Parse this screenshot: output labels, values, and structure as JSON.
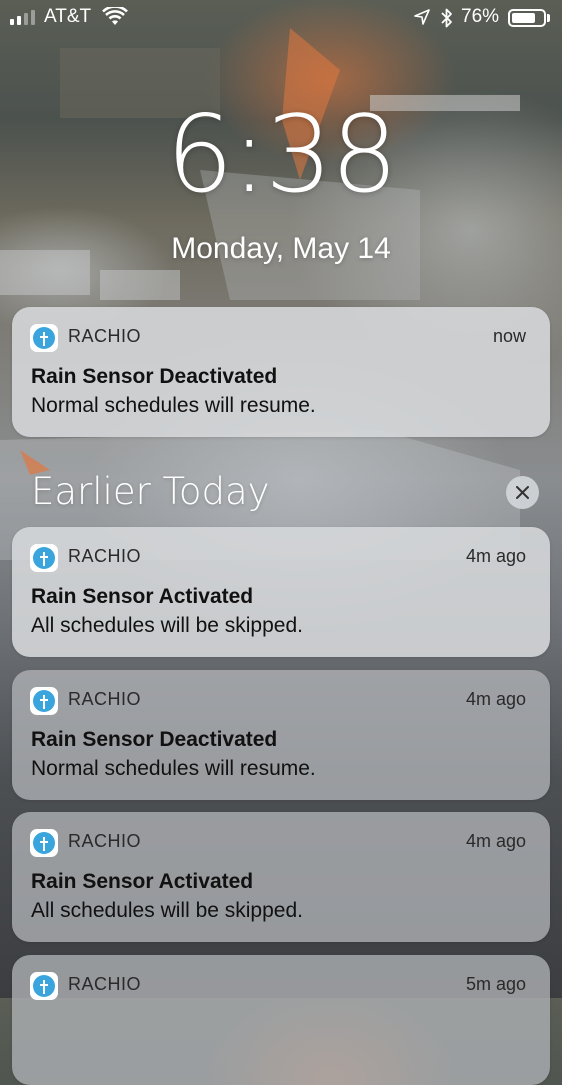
{
  "status_bar": {
    "carrier": "AT&T",
    "battery_percent": "76%",
    "battery_level": 0.76,
    "signal_bars_filled": 2,
    "signal_bars_total": 4
  },
  "lock_screen": {
    "time": "6:38",
    "date": "Monday, May 14"
  },
  "section": {
    "header": "Earlier Today"
  },
  "notifications": [
    {
      "app": "RACHIO",
      "time": "now",
      "title": "Rain Sensor Deactivated",
      "body": "Normal schedules will resume."
    },
    {
      "app": "RACHIO",
      "time": "4m ago",
      "title": "Rain Sensor Activated",
      "body": "All schedules will be skipped."
    },
    {
      "app": "RACHIO",
      "time": "4m ago",
      "title": "Rain Sensor Deactivated",
      "body": "Normal schedules will resume."
    },
    {
      "app": "RACHIO",
      "time": "4m ago",
      "title": "Rain Sensor Activated",
      "body": "All schedules will be skipped."
    },
    {
      "app": "RACHIO",
      "time": "5m ago",
      "title": "",
      "body": ""
    }
  ],
  "colors": {
    "app_icon": "#3aa4dc"
  }
}
